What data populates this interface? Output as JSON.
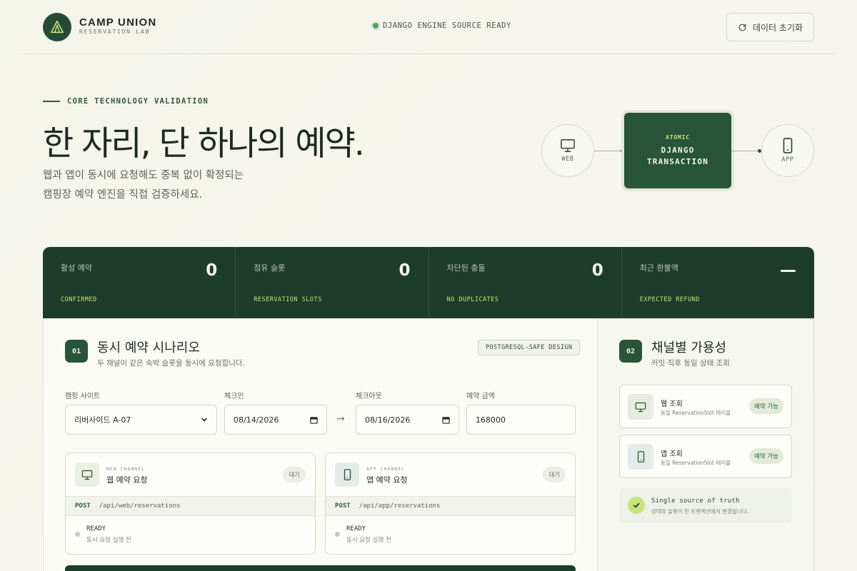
{
  "header": {
    "brand_name": "CAMP UNION",
    "brand_sub": "RESERVATION LAB",
    "status": "DJANGO ENGINE SOURCE READY",
    "reset_label": "데이터 초기화"
  },
  "hero": {
    "eyebrow": "CORE TECHNOLOGY VALIDATION",
    "title": "한 자리, 단 하나의 예약.",
    "desc_line1": "웹과 앱이 동시에 요청해도 중복 없이 확정되는",
    "desc_line2": "캠핑장 예약 엔진을 직접 검증하세요."
  },
  "diagram": {
    "web_label": "WEB",
    "app_label": "APP",
    "core_kicker": "ATOMIC",
    "core_title_line1": "DJANGO",
    "core_title_line2": "TRANSACTION"
  },
  "stats": [
    {
      "label": "활성 예약",
      "value": "0",
      "sub": "CONFIRMED"
    },
    {
      "label": "점유 슬롯",
      "value": "0",
      "sub": "RESERVATION SLOTS"
    },
    {
      "label": "차단된 충돌",
      "value": "0",
      "sub": "NO DUPLICATES"
    },
    {
      "label": "최근 환불액",
      "value": "—",
      "sub": "EXPECTED REFUND"
    }
  ],
  "scenario": {
    "number": "01",
    "title": "동시 예약 시나리오",
    "desc": "두 채널이 같은 숙박 슬롯을 동시에 요청합니다.",
    "tag": "POSTGRESQL-SAFE DESIGN",
    "site_label": "캠핑 사이트",
    "site_value": "리버사이드 A-07",
    "checkin_label": "체크인",
    "checkin_value": "08/14/2026",
    "checkout_label": "체크아웃",
    "checkout_value": "08/16/2026",
    "amount_label": "예약 금액",
    "amount_value": "168000",
    "arrow": "→"
  },
  "channels": [
    {
      "kicker": "WEB CHANNEL",
      "title": "웹 예약 요청",
      "state": "대기",
      "method": "POST",
      "path": "/api/web/reservations",
      "status": "READY",
      "status_sub": "동시 요청 실행 전"
    },
    {
      "kicker": "APP CHANNEL",
      "title": "앱 예약 요청",
      "state": "대기",
      "method": "POST",
      "path": "/api/app/reservations",
      "status": "READY",
      "status_sub": "동시 요청 실행 전"
    }
  ],
  "availability": {
    "number": "02",
    "title": "채널별 가용성",
    "desc": "커밋 직후 동일 상태 조회",
    "items": [
      {
        "title": "웹 조회",
        "sub": "동일 ReservationSlot 테이블",
        "badge": "예약 가능"
      },
      {
        "title": "앱 조회",
        "sub": "동일 ReservationSlot 테이블",
        "badge": "예약 가능"
      }
    ],
    "truth_title": "Single source of truth",
    "truth_sub": "상태와 슬롯이 한 트랜잭션에서 변경됩니다."
  },
  "colors": {
    "primary": "#254a35",
    "accent": "#c9e37a",
    "dark": "#1e3c2a"
  }
}
